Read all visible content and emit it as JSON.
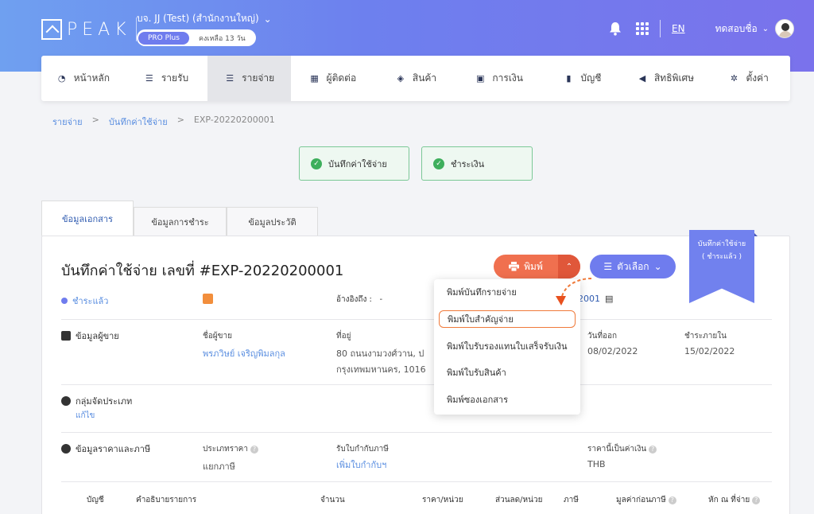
{
  "brand": {
    "logo_text": "PEAK"
  },
  "company": {
    "name": "บจ. JJ (Test) (สำนักงานใหญ่)",
    "plan": "PRO Plus",
    "days_left": "คงเหลือ 13 วัน"
  },
  "topbar": {
    "lang": "EN",
    "user_name": "ทดสอบชื่อ"
  },
  "nav": [
    {
      "label": "หน้าหลัก",
      "icon": "dashboard-icon"
    },
    {
      "label": "รายรับ",
      "icon": "list-icon"
    },
    {
      "label": "รายจ่าย",
      "icon": "list-icon"
    },
    {
      "label": "ผู้ติดต่อ",
      "icon": "building-icon"
    },
    {
      "label": "สินค้า",
      "icon": "box-icon"
    },
    {
      "label": "การเงิน",
      "icon": "money-icon"
    },
    {
      "label": "บัญชี",
      "icon": "book-icon"
    },
    {
      "label": "สิทธิพิเศษ",
      "icon": "megaphone-icon"
    },
    {
      "label": "ตั้งค่า",
      "icon": "gear-icon"
    }
  ],
  "breadcrumb": {
    "level1": "รายจ่าย",
    "sep": ">",
    "level2": "บันทึกค่าใช้จ่าย",
    "level3": "EXP-20220200001"
  },
  "status_cards": {
    "first": "บันทึกค่าใช้จ่าย",
    "second": "ชำระเงิน"
  },
  "tabs": [
    "ข้อมูลเอกสาร",
    "ข้อมูลการชำระ",
    "ข้อมูลประวัติ"
  ],
  "doc": {
    "title": "บันทึกค่าใช้จ่าย เลขที่ #EXP-20220200001",
    "paid_status": "ชำระแล้ว",
    "ref_label": "อ้างอิงถึง :",
    "ref_value": "-",
    "ref_no_partial": "2001",
    "print_label": "พิมพ์",
    "options_label": "ตัวเลือก",
    "ribbon_line1": "บันทึกค่าใช้จ่าย",
    "ribbon_line2": "( ชำระแล้ว )"
  },
  "vendor": {
    "heading": "ข้อมูลผู้ขาย",
    "name_label": "ชื่อผู้ขาย",
    "name_value": "พรภวิษย์ เจริญพิมลกุล",
    "address_label": "ที่อยู่",
    "address_line1": "80 ถนนงามวงศ์วาน, ป",
    "address_line2": "กรุงเทพมหานคร, 1016",
    "issue_date_label": "วันที่ออก",
    "issue_date": "08/02/2022",
    "due_label": "ชำระภายใน",
    "due_date": "15/02/2022"
  },
  "classification": {
    "heading": "กลุ่มจัดประเภท",
    "edit_link": "แก้ไข"
  },
  "pricing": {
    "heading": "ข้อมูลราคาและภาษี",
    "price_type_label": "ประเภทราคา",
    "price_type_value": "แยกภาษี",
    "wht_label": "รับใบกำกับภาษี",
    "wht_link": "เพิ่มใบกำกับฯ",
    "currency_label": "ราคานี้เป็นค่าเงิน",
    "currency_value": "THB"
  },
  "table_headers": [
    "บัญชี",
    "คำอธิบายรายการ",
    "จำนวน",
    "ราคา/หน่วย",
    "ส่วนลด/หน่วย",
    "ภาษี",
    "มูลค่าก่อนภาษี",
    "หัก ณ ที่จ่าย"
  ],
  "print_menu": [
    "พิมพ์บันทึกรายจ่าย",
    "พิมพ์ใบสำคัญจ่าย",
    "พิมพ์ใบรับรองแทนใบเสร็จรับเงิน",
    "พิมพ์ใบรับสินค้า",
    "พิมพ์ซองเอกสาร"
  ],
  "colors": {
    "accent": "#6f7cee",
    "print": "#f0704f",
    "success": "#3eaf5c",
    "highlight": "#f07a3a"
  }
}
